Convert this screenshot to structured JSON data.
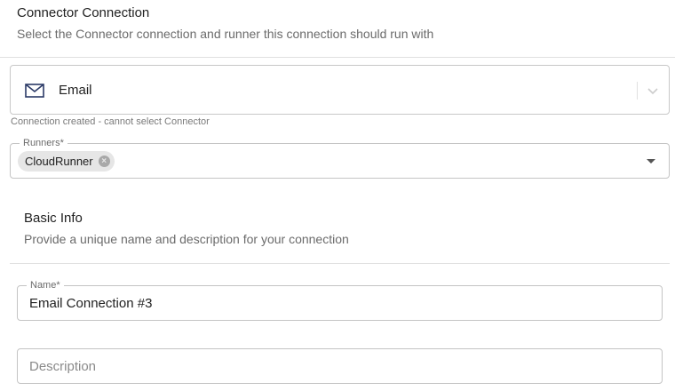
{
  "connector_section": {
    "title": "Connector Connection",
    "description": "Select the Connector connection and runner this connection should run with",
    "connector": {
      "value": "Email",
      "icon": "mail-icon",
      "helper": "Connection created - cannot select Connector"
    },
    "runners": {
      "label": "Runners*",
      "chips": [
        "CloudRunner"
      ]
    }
  },
  "basic_info": {
    "title": "Basic Info",
    "description": "Provide a unique name and description for your connection",
    "name": {
      "label": "Name*",
      "value": "Email Connection #3"
    },
    "description_field": {
      "placeholder": "Description",
      "value": ""
    }
  },
  "colors": {
    "border": "#c4c4c4",
    "chip_bg": "#e6e6e6",
    "text": "#212121",
    "muted": "#6b6b6b"
  }
}
